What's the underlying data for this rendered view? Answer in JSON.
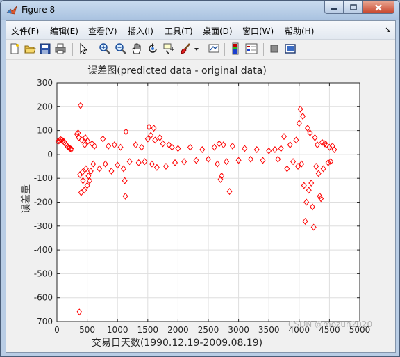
{
  "window": {
    "title": "Figure 8"
  },
  "menus": [
    "文件(F)",
    "编辑(E)",
    "查看(V)",
    "插入(I)",
    "工具(T)",
    "桌面(D)",
    "窗口(W)",
    "帮助(H)"
  ],
  "toolbar_icons": [
    "new-figure-icon",
    "open-file-icon",
    "save-icon",
    "print-icon",
    "edit-plot-arrow-icon",
    "zoom-in-icon",
    "zoom-out-icon",
    "pan-hand-icon",
    "rotate-3d-icon",
    "data-cursor-icon",
    "brush-icon",
    "brush-dropdown-icon",
    "link-plot-icon",
    "insert-colorbar-icon",
    "insert-legend-icon",
    "hide-plot-tools-icon",
    "show-plot-tools-icon"
  ],
  "watermark": "CSDN @mozun2020",
  "colors": {
    "marker": "#ff0000",
    "grid": "#dedede"
  },
  "chart_data": {
    "type": "scatter",
    "title": "误差图(predicted data - original data)",
    "xlabel": "交易日天数(1990.12.19-2009.08.19)",
    "ylabel": "误差量",
    "xlim": [
      0,
      5000
    ],
    "ylim": [
      -700,
      300
    ],
    "xticks": [
      0,
      500,
      1000,
      1500,
      2000,
      2500,
      3000,
      3500,
      4000,
      4500,
      5000
    ],
    "yticks": [
      300,
      200,
      100,
      0,
      -100,
      -200,
      -300,
      -400,
      -500,
      -600,
      -700
    ],
    "grid": true,
    "marker": "diamond",
    "series": [
      {
        "points": [
          [
            20,
            55
          ],
          [
            40,
            58
          ],
          [
            60,
            62
          ],
          [
            80,
            60
          ],
          [
            100,
            57
          ],
          [
            120,
            52
          ],
          [
            140,
            45
          ],
          [
            160,
            38
          ],
          [
            180,
            32
          ],
          [
            200,
            28
          ],
          [
            220,
            24
          ],
          [
            240,
            22
          ],
          [
            330,
            85
          ],
          [
            350,
            90
          ],
          [
            360,
            70
          ],
          [
            370,
            -660
          ],
          [
            380,
            -85
          ],
          [
            390,
            205
          ],
          [
            400,
            -160
          ],
          [
            410,
            60
          ],
          [
            420,
            -75
          ],
          [
            430,
            -110
          ],
          [
            450,
            -150
          ],
          [
            460,
            40
          ],
          [
            470,
            70
          ],
          [
            480,
            -60
          ],
          [
            500,
            -130
          ],
          [
            510,
            55
          ],
          [
            520,
            -90
          ],
          [
            540,
            -110
          ],
          [
            560,
            -70
          ],
          [
            580,
            45
          ],
          [
            600,
            -40
          ],
          [
            620,
            35
          ],
          [
            700,
            -60
          ],
          [
            760,
            65
          ],
          [
            800,
            -40
          ],
          [
            850,
            35
          ],
          [
            900,
            -70
          ],
          [
            950,
            40
          ],
          [
            1000,
            -45
          ],
          [
            1050,
            30
          ],
          [
            1100,
            -60
          ],
          [
            1120,
            -110
          ],
          [
            1130,
            -175
          ],
          [
            1140,
            95
          ],
          [
            1200,
            -30
          ],
          [
            1300,
            40
          ],
          [
            1350,
            -35
          ],
          [
            1400,
            30
          ],
          [
            1450,
            -30
          ],
          [
            1500,
            65
          ],
          [
            1520,
            115
          ],
          [
            1550,
            80
          ],
          [
            1570,
            -40
          ],
          [
            1600,
            110
          ],
          [
            1620,
            60
          ],
          [
            1650,
            -55
          ],
          [
            1700,
            70
          ],
          [
            1750,
            45
          ],
          [
            1800,
            -50
          ],
          [
            1850,
            40
          ],
          [
            1900,
            30
          ],
          [
            1950,
            -35
          ],
          [
            2000,
            25
          ],
          [
            2100,
            -30
          ],
          [
            2200,
            30
          ],
          [
            2300,
            -25
          ],
          [
            2400,
            20
          ],
          [
            2500,
            -20
          ],
          [
            2600,
            30
          ],
          [
            2650,
            -40
          ],
          [
            2680,
            45
          ],
          [
            2700,
            -105
          ],
          [
            2720,
            -90
          ],
          [
            2750,
            40
          ],
          [
            2800,
            -30
          ],
          [
            2850,
            -155
          ],
          [
            2900,
            35
          ],
          [
            3000,
            -25
          ],
          [
            3100,
            25
          ],
          [
            3200,
            -20
          ],
          [
            3300,
            20
          ],
          [
            3400,
            -25
          ],
          [
            3500,
            15
          ],
          [
            3600,
            20
          ],
          [
            3650,
            -20
          ],
          [
            3700,
            25
          ],
          [
            3750,
            75
          ],
          [
            3800,
            -60
          ],
          [
            3850,
            40
          ],
          [
            3900,
            -30
          ],
          [
            3950,
            60
          ],
          [
            3980,
            -50
          ],
          [
            4000,
            130
          ],
          [
            4020,
            190
          ],
          [
            4040,
            -40
          ],
          [
            4060,
            160
          ],
          [
            4080,
            -130
          ],
          [
            4100,
            -280
          ],
          [
            4120,
            -200
          ],
          [
            4140,
            110
          ],
          [
            4160,
            -150
          ],
          [
            4180,
            90
          ],
          [
            4200,
            -120
          ],
          [
            4220,
            -220
          ],
          [
            4240,
            -305
          ],
          [
            4260,
            70
          ],
          [
            4280,
            -50
          ],
          [
            4300,
            40
          ],
          [
            4320,
            -80
          ],
          [
            4340,
            -175
          ],
          [
            4360,
            -185
          ],
          [
            4380,
            50
          ],
          [
            4400,
            -60
          ],
          [
            4420,
            45
          ],
          [
            4450,
            40
          ],
          [
            4480,
            -35
          ],
          [
            4500,
            30
          ],
          [
            4520,
            -30
          ],
          [
            4550,
            35
          ],
          [
            4580,
            20
          ]
        ]
      }
    ]
  }
}
